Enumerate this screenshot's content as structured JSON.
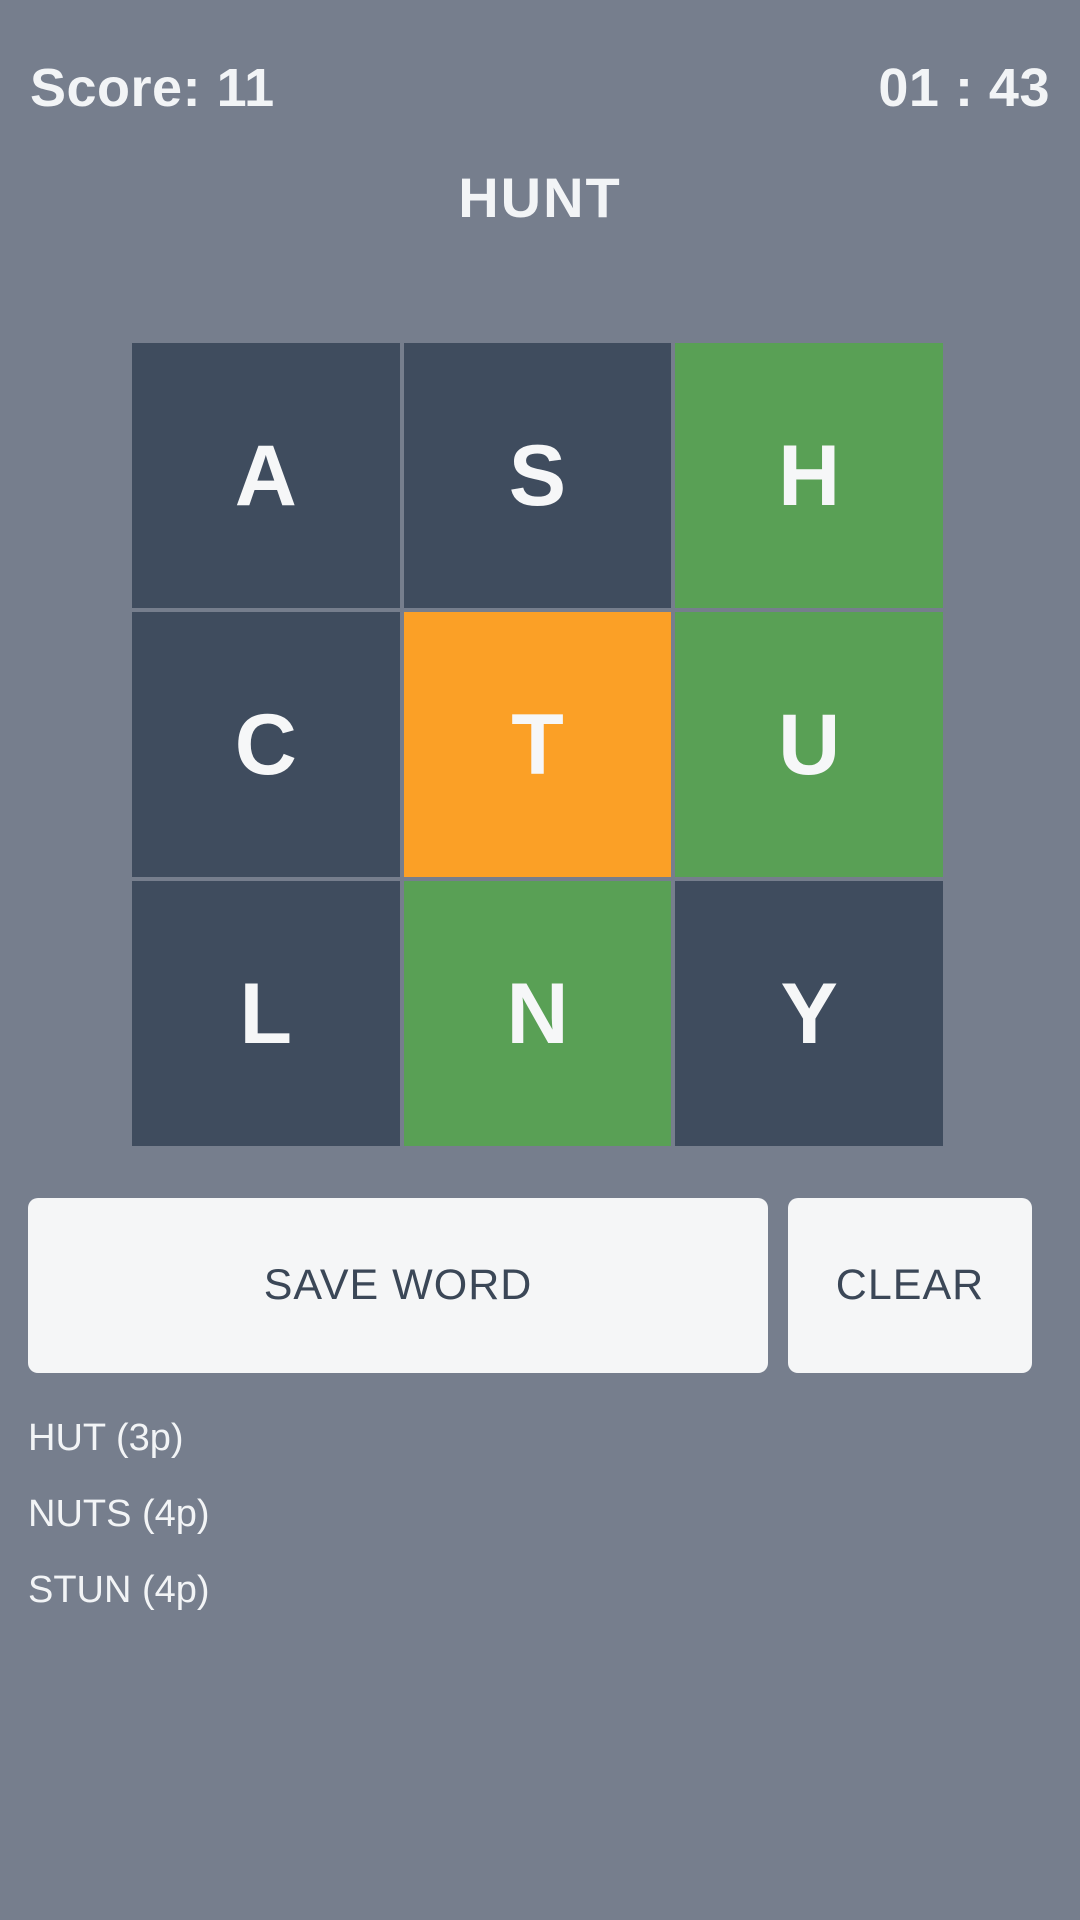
{
  "hud": {
    "score_label": "Score: 11",
    "score_value": 11,
    "timer_label": "01 : 43",
    "timer_minutes": "01",
    "timer_seconds": "43"
  },
  "current_word": "HUNT",
  "grid": {
    "rows": 3,
    "cols": 3,
    "tiles": [
      {
        "letter": "A",
        "state": "default"
      },
      {
        "letter": "S",
        "state": "default"
      },
      {
        "letter": "H",
        "state": "selected"
      },
      {
        "letter": "C",
        "state": "default"
      },
      {
        "letter": "T",
        "state": "active"
      },
      {
        "letter": "U",
        "state": "selected"
      },
      {
        "letter": "L",
        "state": "default"
      },
      {
        "letter": "N",
        "state": "selected"
      },
      {
        "letter": "Y",
        "state": "default"
      }
    ]
  },
  "actions": {
    "save_label": "SAVE WORD",
    "clear_label": "CLEAR"
  },
  "words": [
    {
      "text": "HUT (3p)",
      "word": "HUT",
      "points": 3
    },
    {
      "text": "NUTS (4p)",
      "word": "NUTS",
      "points": 4
    },
    {
      "text": "STUN (4p)",
      "word": "STUN",
      "points": 4
    }
  ],
  "colors": {
    "background": "#767e8d",
    "tile_default": "#3f4c5e",
    "tile_selected": "#59a055",
    "tile_active": "#fba026",
    "button_background": "#f5f6f7",
    "button_text": "#3b4757",
    "text_primary": "#f2f4f6"
  }
}
